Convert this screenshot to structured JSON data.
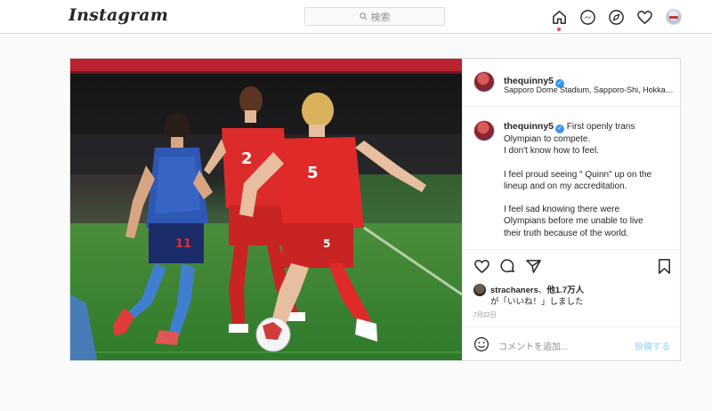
{
  "nav": {
    "logo": "Instagram",
    "search_placeholder": "検索",
    "icons": [
      "home-icon",
      "messenger-icon",
      "explore-icon",
      "heart-icon",
      "profile-avatar"
    ]
  },
  "post": {
    "username": "thequinny5",
    "location": "Sapporo Dome Stadium, Sapporo-Shi, Hokkaido",
    "caption_username": "thequinny5",
    "caption_first": "First openly trans",
    "caption_lines": [
      "Olympian to compete.",
      "I don't know how to feel.",
      "",
      "I feel proud seeing \" Quinn\" up on the",
      "lineup and on my accreditation.",
      "",
      "I feel sad knowing there were",
      "Olympians before me unable to live",
      "their truth because of the world."
    ],
    "likes_user": "strachaners",
    "likes_sep": "、",
    "likes_count": "他1.7万人",
    "likes_suffix": "が「いいね！」しました",
    "date": "7月22日",
    "comment_placeholder": "コメントを追加...",
    "post_button": "投稿する",
    "photo": {
      "players": [
        {
          "team": "Canada",
          "number": "5"
        },
        {
          "team": "Canada",
          "number": "2"
        },
        {
          "team": "Japan",
          "number": "11"
        }
      ]
    }
  },
  "colors": {
    "accent_blue": "#3897f0",
    "notification_red": "#ed4956",
    "post_button_disabled": "#b2dffc",
    "canada_red": "#e02a2a",
    "japan_blue": "#1f3f8f",
    "pitch_green": "#3f8a35"
  }
}
